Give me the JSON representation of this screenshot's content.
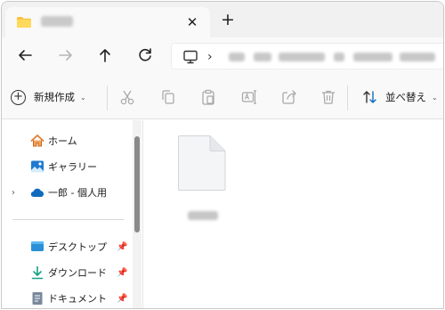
{
  "tab": {
    "close_glyph": "✕",
    "new_glyph": "+"
  },
  "address": {
    "separator": "›"
  },
  "toolbar": {
    "new_label": "新規作成",
    "new_caret": "⌄",
    "sort_label": "並べ替え",
    "sort_caret": "⌄",
    "icons": [
      "cut-icon",
      "copy-icon",
      "paste-icon",
      "rename-icon",
      "share-icon",
      "delete-icon"
    ]
  },
  "sidebar": {
    "items": [
      {
        "label": "ホーム",
        "icon": "home-icon"
      },
      {
        "label": "ギャラリー",
        "icon": "gallery-icon"
      },
      {
        "label": "一郎 - 個人用",
        "icon": "onedrive-icon",
        "expander": "›"
      },
      {
        "label": "デスクトップ",
        "icon": "desktop-icon",
        "pinned": true
      },
      {
        "label": "ダウンロード",
        "icon": "download-icon",
        "pinned": true
      },
      {
        "label": "ドキュメント",
        "icon": "documents-icon",
        "pinned": true
      }
    ],
    "pin_glyph": "📌"
  },
  "colors": {
    "accent": "#0f6cbd",
    "folder": "#f6c344",
    "home": "#e07b32"
  }
}
